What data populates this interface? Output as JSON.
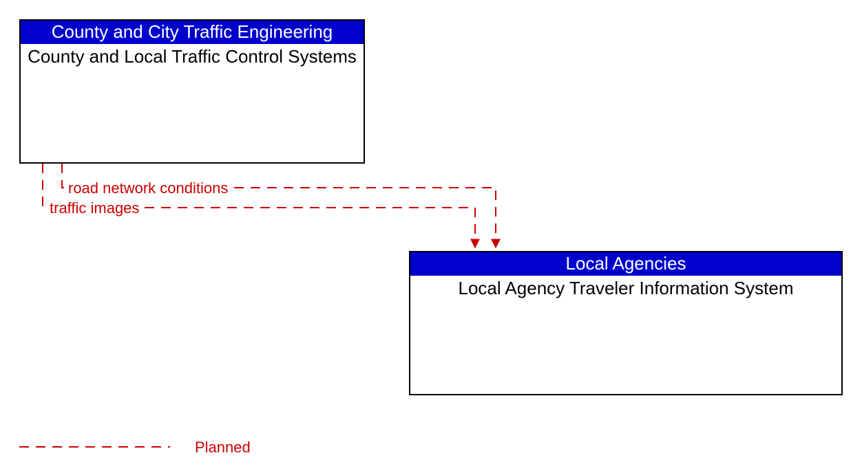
{
  "nodes": {
    "nodeA": {
      "header": "County and City Traffic Engineering",
      "body": "County and Local Traffic Control Systems"
    },
    "nodeB": {
      "header": "Local Agencies",
      "body": "Local Agency Traveler Information System"
    }
  },
  "flows": {
    "flow1": "road network conditions",
    "flow2": "traffic images"
  },
  "legend": {
    "planned": "Planned"
  },
  "colors": {
    "header_bg": "#0000cc",
    "header_text": "#ffffff",
    "flow": "#cc0000",
    "border": "#000000"
  }
}
